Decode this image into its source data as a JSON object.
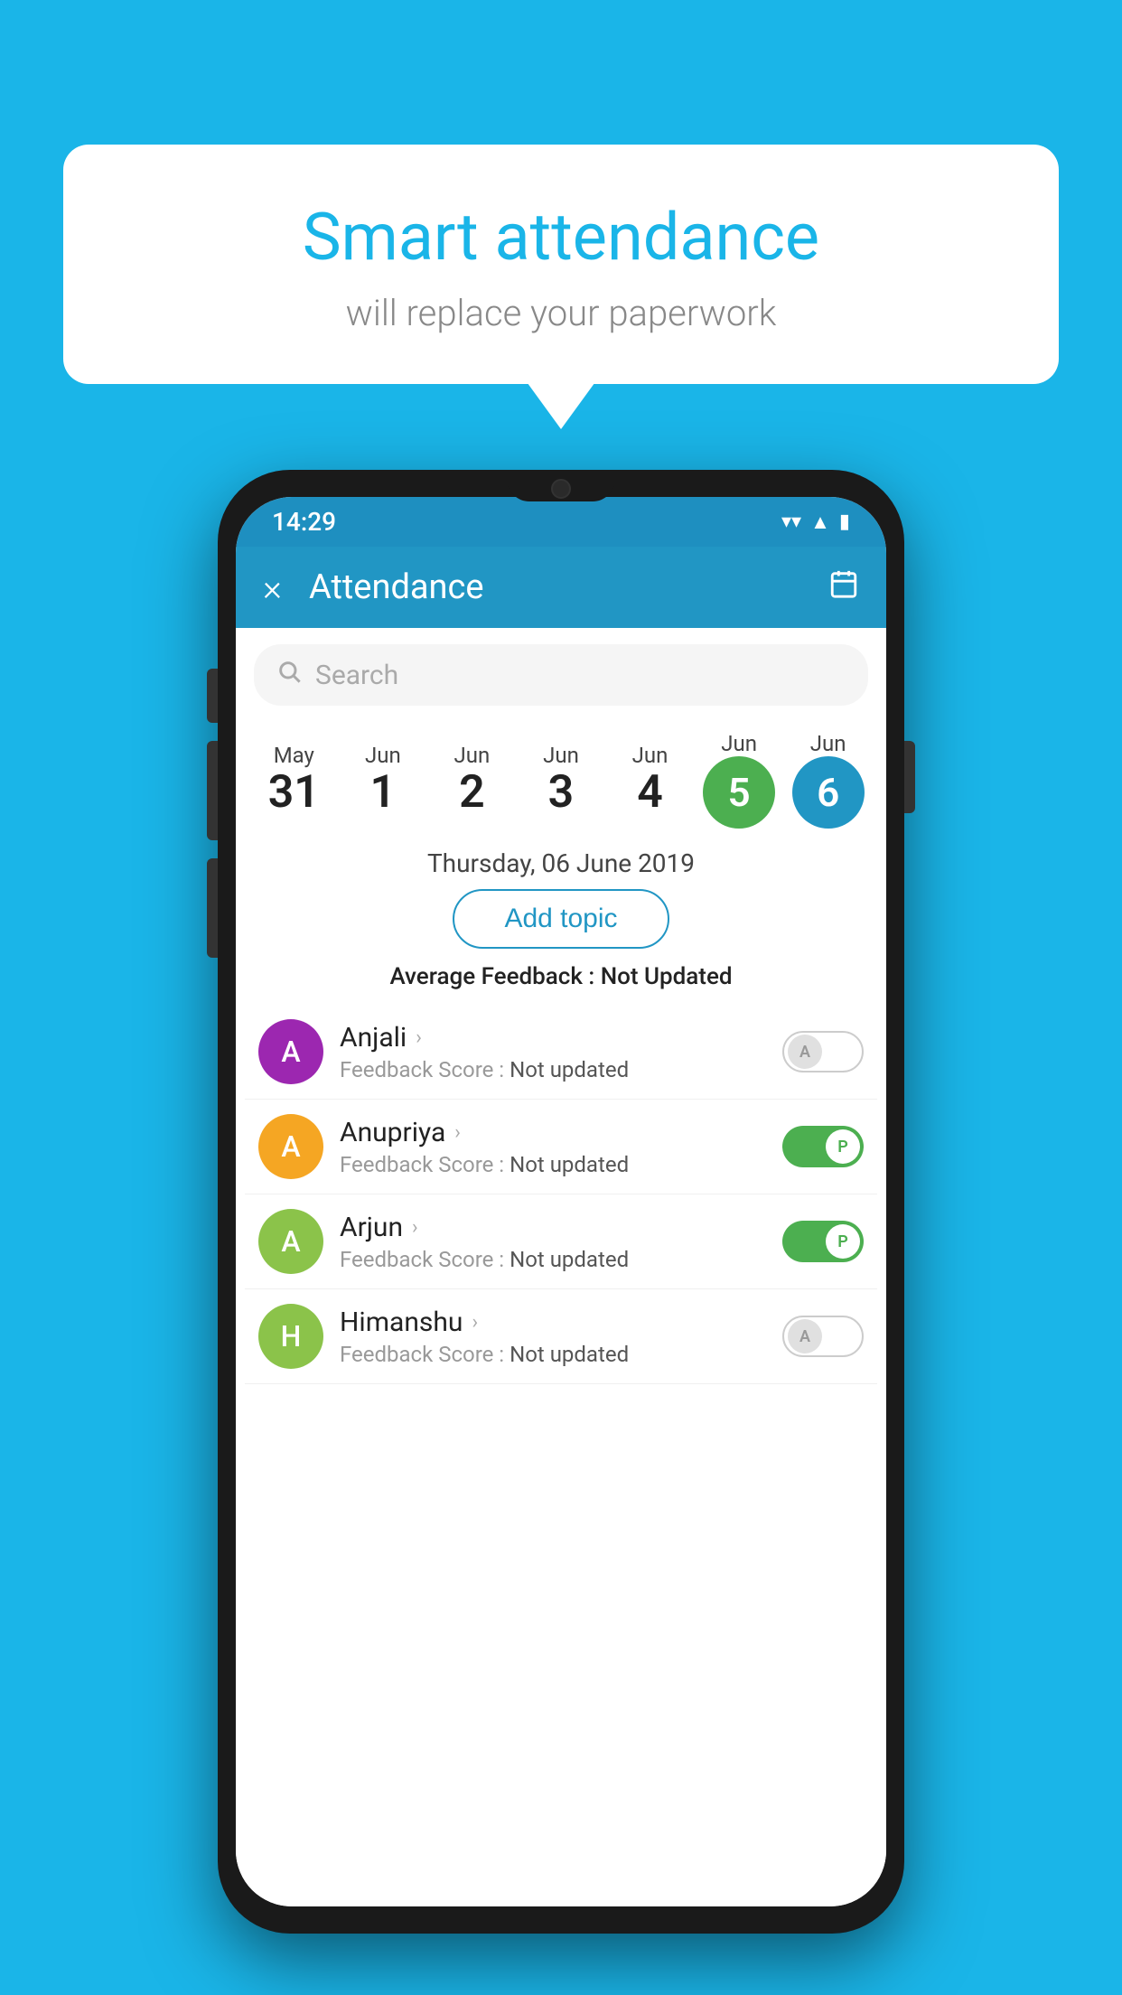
{
  "background_color": "#1ab5e8",
  "speech_bubble": {
    "title": "Smart attendance",
    "subtitle": "will replace your paperwork"
  },
  "status_bar": {
    "time": "14:29",
    "icons": [
      "wifi",
      "signal",
      "battery"
    ]
  },
  "app_bar": {
    "title": "Attendance",
    "close_icon": "×",
    "calendar_icon": "📅"
  },
  "search": {
    "placeholder": "Search"
  },
  "dates": [
    {
      "month": "May",
      "day": "31",
      "state": "normal"
    },
    {
      "month": "Jun",
      "day": "1",
      "state": "normal"
    },
    {
      "month": "Jun",
      "day": "2",
      "state": "normal"
    },
    {
      "month": "Jun",
      "day": "3",
      "state": "normal"
    },
    {
      "month": "Jun",
      "day": "4",
      "state": "normal"
    },
    {
      "month": "Jun",
      "day": "5",
      "state": "today"
    },
    {
      "month": "Jun",
      "day": "6",
      "state": "selected"
    }
  ],
  "selected_date_label": "Thursday, 06 June 2019",
  "add_topic_button": "Add topic",
  "average_feedback": {
    "label": "Average Feedback : ",
    "value": "Not Updated"
  },
  "students": [
    {
      "name": "Anjali",
      "avatar_letter": "A",
      "avatar_color": "#9c27b0",
      "feedback_label": "Feedback Score : ",
      "feedback_value": "Not updated",
      "toggle": "off",
      "toggle_letter": "A"
    },
    {
      "name": "Anupriya",
      "avatar_letter": "A",
      "avatar_color": "#f5a623",
      "feedback_label": "Feedback Score : ",
      "feedback_value": "Not updated",
      "toggle": "on",
      "toggle_letter": "P"
    },
    {
      "name": "Arjun",
      "avatar_letter": "A",
      "avatar_color": "#8bc34a",
      "feedback_label": "Feedback Score : ",
      "feedback_value": "Not updated",
      "toggle": "on",
      "toggle_letter": "P"
    },
    {
      "name": "Himanshu",
      "avatar_letter": "H",
      "avatar_color": "#8bc34a",
      "feedback_label": "Feedback Score : ",
      "feedback_value": "Not updated",
      "toggle": "off",
      "toggle_letter": "A"
    }
  ]
}
